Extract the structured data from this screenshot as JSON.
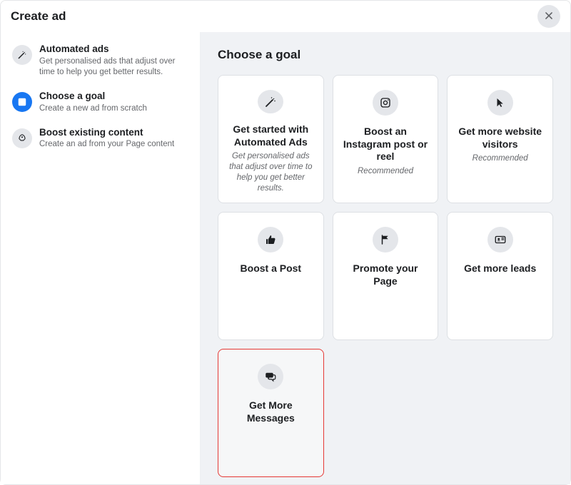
{
  "header": {
    "title": "Create ad"
  },
  "sidebar": {
    "items": [
      {
        "title": "Automated ads",
        "sub": "Get personalised ads that adjust over time to help you get better results."
      },
      {
        "title": "Choose a goal",
        "sub": "Create a new ad from scratch"
      },
      {
        "title": "Boost existing content",
        "sub": "Create an ad from your Page content"
      }
    ]
  },
  "main": {
    "title": "Choose a goal",
    "goals": [
      {
        "title": "Get started with Automated Ads",
        "sub": "Get personalised ads that adjust over time to help you get better results."
      },
      {
        "title": "Boost an Instagram post or reel",
        "sub": "Recommended"
      },
      {
        "title": "Get more website visitors",
        "sub": "Recommended"
      },
      {
        "title": "Boost a Post",
        "sub": ""
      },
      {
        "title": "Promote your Page",
        "sub": ""
      },
      {
        "title": "Get more leads",
        "sub": ""
      },
      {
        "title": "Get More Messages",
        "sub": ""
      }
    ]
  }
}
